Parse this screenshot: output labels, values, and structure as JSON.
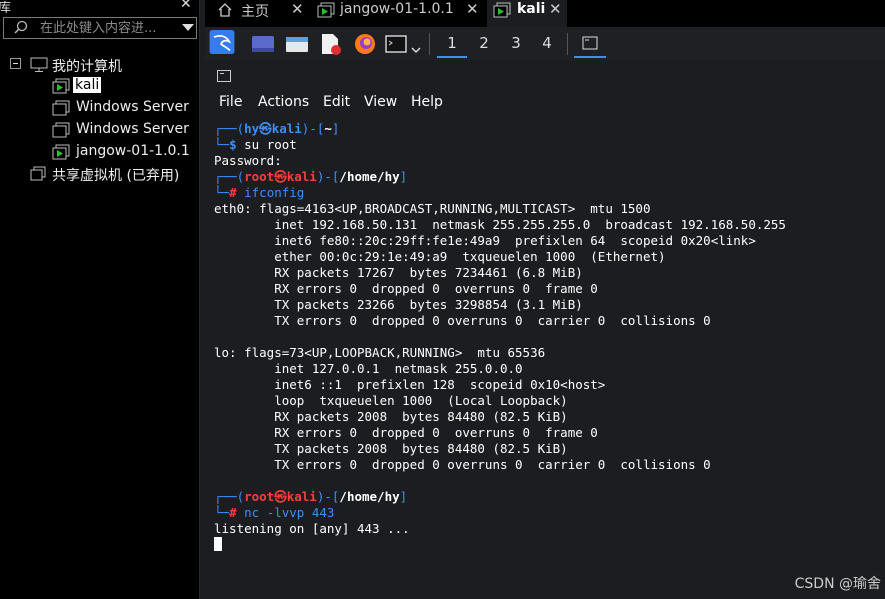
{
  "library": {
    "title": "库",
    "search_placeholder": "在此处键入内容进...",
    "root": "我的计算机",
    "vms": [
      "kali",
      "Windows Server",
      "Windows Server",
      "jangow-01-1.0.1"
    ],
    "shared": "共享虚拟机 (已弃用)"
  },
  "tabs": [
    {
      "label": "主页"
    },
    {
      "label": "jangow-01-1.0.1"
    },
    {
      "label": "kali"
    }
  ],
  "panel": {
    "workspaces": [
      "1",
      "2",
      "3",
      "4"
    ],
    "active_workspace": "1"
  },
  "menu": [
    "File",
    "Actions",
    "Edit",
    "View",
    "Help"
  ],
  "terminal": {
    "p1_user": "hy",
    "p1_host": "kali",
    "p1_dir": "~",
    "cmd1": "su root",
    "password_line": "Password:",
    "root_user": "root",
    "root_host": "kali",
    "root_dir": "/home/hy",
    "cmd2": "ifconfig",
    "output": [
      "eth0: flags=4163<UP,BROADCAST,RUNNING,MULTICAST>  mtu 1500",
      "        inet 192.168.50.131  netmask 255.255.255.0  broadcast 192.168.50.255",
      "        inet6 fe80::20c:29ff:fe1e:49a9  prefixlen 64  scopeid 0x20<link>",
      "        ether 00:0c:29:1e:49:a9  txqueuelen 1000  (Ethernet)",
      "        RX packets 17267  bytes 7234461 (6.8 MiB)",
      "        RX errors 0  dropped 0  overruns 0  frame 0",
      "        TX packets 23266  bytes 3298854 (3.1 MiB)",
      "        TX errors 0  dropped 0 overruns 0  carrier 0  collisions 0",
      "",
      "lo: flags=73<UP,LOOPBACK,RUNNING>  mtu 65536",
      "        inet 127.0.0.1  netmask 255.0.0.0",
      "        inet6 ::1  prefixlen 128  scopeid 0x10<host>",
      "        loop  txqueuelen 1000  (Local Loopback)",
      "        RX packets 2008  bytes 84480 (82.5 KiB)",
      "        RX errors 0  dropped 0  overruns 0  frame 0",
      "        TX packets 2008  bytes 84480 (82.5 KiB)",
      "        TX errors 0  dropped 0 overruns 0  carrier 0  collisions 0",
      ""
    ],
    "cmd3": "nc -lvvp 443",
    "listening": "listening on [any] 443 ..."
  },
  "watermark": "CSDN @瑜舍",
  "colors": {
    "accent_blue": "#3e8ef7",
    "root_red": "#ff3c3c",
    "vm_green": "#2fbf2f"
  }
}
